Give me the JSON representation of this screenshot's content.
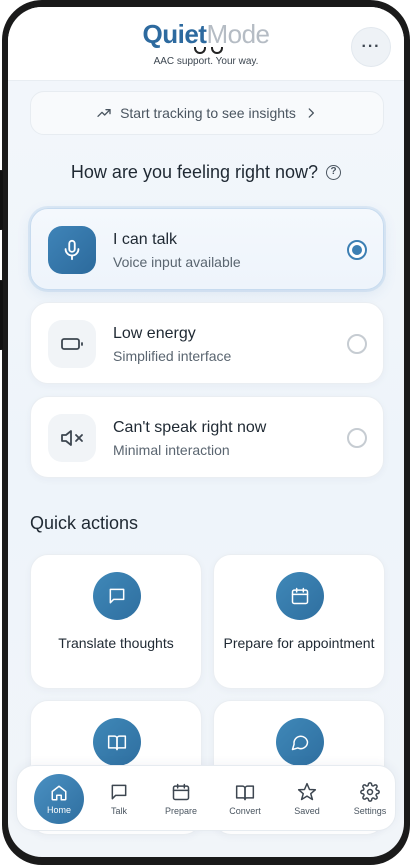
{
  "app": {
    "logo_primary": "Quiet",
    "logo_secondary": "Mode",
    "tagline": "AAC support. Your way.",
    "more_label": "···"
  },
  "insights": {
    "label": "Start tracking to see insights"
  },
  "question": {
    "text": "How are you feeling right now?"
  },
  "modes": [
    {
      "title": "I can talk",
      "subtitle": "Voice input available",
      "icon": "microphone-icon",
      "selected": true
    },
    {
      "title": "Low energy",
      "subtitle": "Simplified interface",
      "icon": "battery-low-icon",
      "selected": false
    },
    {
      "title": "Can't speak right now",
      "subtitle": "Minimal interaction",
      "icon": "speaker-muted-icon",
      "selected": false
    }
  ],
  "quick_actions": {
    "title": "Quick actions",
    "items": [
      {
        "label": "Translate thoughts",
        "icon": "chat-bubble-icon"
      },
      {
        "label": "Prepare for appointment",
        "icon": "calendar-icon"
      },
      {
        "label": "",
        "icon": "book-icon"
      },
      {
        "label": "",
        "icon": "chat-round-icon"
      }
    ]
  },
  "nav": {
    "items": [
      {
        "label": "Home",
        "icon": "home-icon",
        "active": true
      },
      {
        "label": "Talk",
        "icon": "message-icon",
        "active": false
      },
      {
        "label": "Prepare",
        "icon": "calendar-icon",
        "active": false
      },
      {
        "label": "Convert",
        "icon": "book-icon",
        "active": false
      },
      {
        "label": "Saved",
        "icon": "star-icon",
        "active": false
      },
      {
        "label": "Settings",
        "icon": "gear-icon",
        "active": false
      }
    ]
  },
  "colors": {
    "brand": "#2d6a9f",
    "accent": "#3c7fb3",
    "text": "#1f2933",
    "muted": "#5a6570"
  }
}
